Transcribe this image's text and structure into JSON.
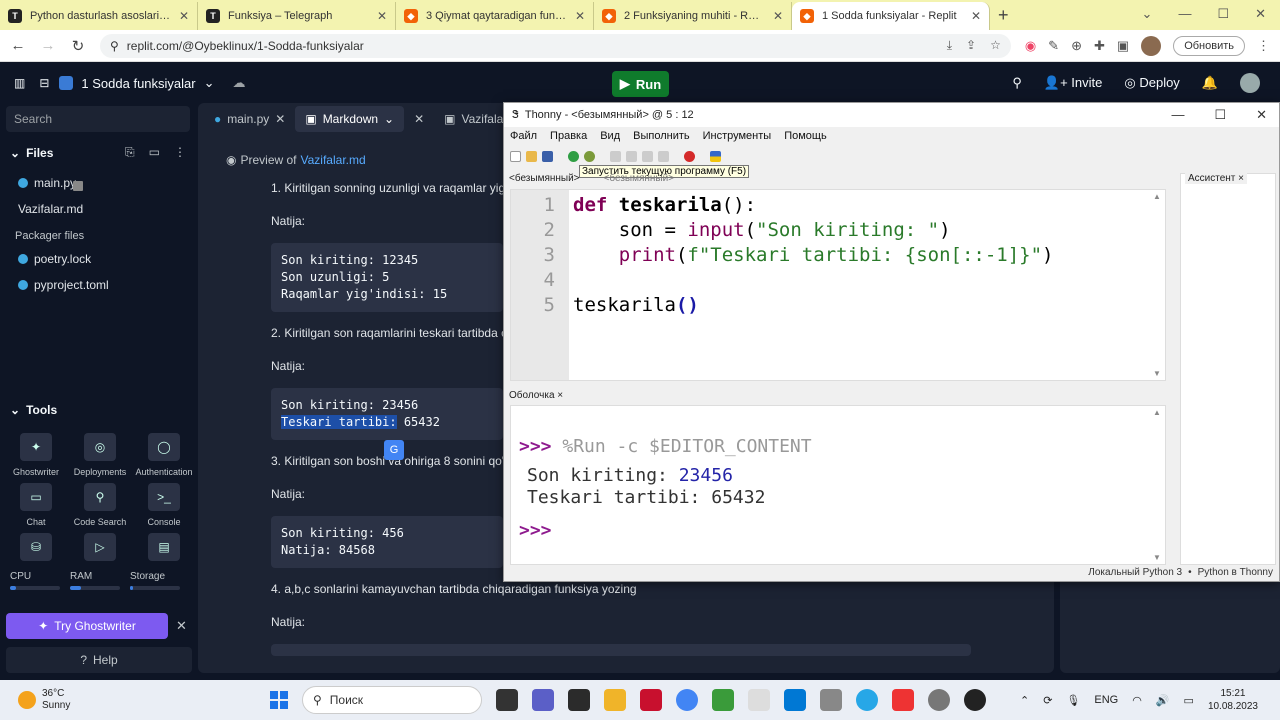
{
  "browser": {
    "tabs": [
      {
        "label": "Python dasturlash asoslari – Tele",
        "icon": "T",
        "active": false
      },
      {
        "label": "Funksiya – Telegraph",
        "icon": "T",
        "active": false
      },
      {
        "label": "3 Qiymat qaytaradigan funksiya",
        "icon": "R",
        "active": false
      },
      {
        "label": "2 Funksiyaning muhiti - Replit",
        "icon": "R",
        "active": false
      },
      {
        "label": "1 Sodda funksiyalar - Replit",
        "icon": "R",
        "active": true
      }
    ],
    "url": "replit.com/@Oybeklinux/1-Sodda-funksiyalar",
    "update_label": "Обновить"
  },
  "replit": {
    "project_name": "1 Sodda funksiyalar",
    "run_label": "Run",
    "invite_label": "Invite",
    "deploy_label": "Deploy",
    "search_placeholder": "Search",
    "files_heading": "Files",
    "files": [
      "main.py",
      "Vazifalar.md"
    ],
    "packager_heading": "Packager files",
    "packager_files": [
      "poetry.lock",
      "pyproject.toml"
    ],
    "tools_heading": "Tools",
    "tools": [
      "Ghostwriter",
      "Deployments",
      "Authentication",
      "Chat",
      "Code Search",
      "Console"
    ],
    "meters": [
      {
        "label": "CPU",
        "level": 0.12
      },
      {
        "label": "RAM",
        "level": 0.22
      },
      {
        "label": "Storage",
        "level": 0.05
      }
    ],
    "try_ghostwriter": "Try Ghostwriter",
    "help_label": "Help",
    "editor_tabs": [
      "main.py",
      "Markdown",
      "Vazifalar.md"
    ],
    "preview_prefix": "Preview of",
    "preview_file": "Vazifalar.md",
    "markdown": {
      "q1": "1. Kiritilgan sonning uzunligi va raqamlar yig'",
      "natija": "Natija:",
      "code1": [
        "Son kiriting: 12345",
        "Son uzunligi: 5",
        "Raqamlar yig'indisi: 15"
      ],
      "q2": "2. Kiritilgan son raqamlarini teskari tartibda c",
      "code2_line1": "Son kiriting: 23456",
      "code2_hl": "Teskari tartibi:",
      "code2_rest": " 65432",
      "q3": "3. Kiritilgan son boshi va ohiriga 8 sonini qo's",
      "code3": [
        "Son kiriting: 456",
        "Natija: 84568"
      ],
      "q4": "4. a,b,c sonlarini kamayuvchan tartibda chiqaradigan funksiya yozing"
    }
  },
  "thonny": {
    "title": "Thonny  -  <безымянный>  @  5 : 12",
    "menu": [
      "Файл",
      "Правка",
      "Вид",
      "Выполнить",
      "Инструменты",
      "Помощь"
    ],
    "tooltip": "Запустить текущую программу (F5)",
    "editor_tabs": [
      "<безымянный>",
      "<безымянный>"
    ],
    "line_numbers": [
      "1",
      "2",
      "3",
      "4",
      "5"
    ],
    "assistant_tab": "Ассистент",
    "shell_tab": "Оболочка",
    "shell": {
      "prompt": ">>>",
      "command": " %Run -c $EDITOR_CONTENT",
      "out1_label": "Son kiriting: ",
      "out1_input": "23456",
      "out2": "Teskari tartibi: 65432"
    },
    "status": [
      "Локальный Python 3",
      "•",
      "Python в Thonny"
    ]
  },
  "taskbar": {
    "temperature": "36°C",
    "weather": "Sunny",
    "search_label": "Поиск",
    "language": "ENG",
    "time": "15:21",
    "date": "10.08.2023"
  }
}
